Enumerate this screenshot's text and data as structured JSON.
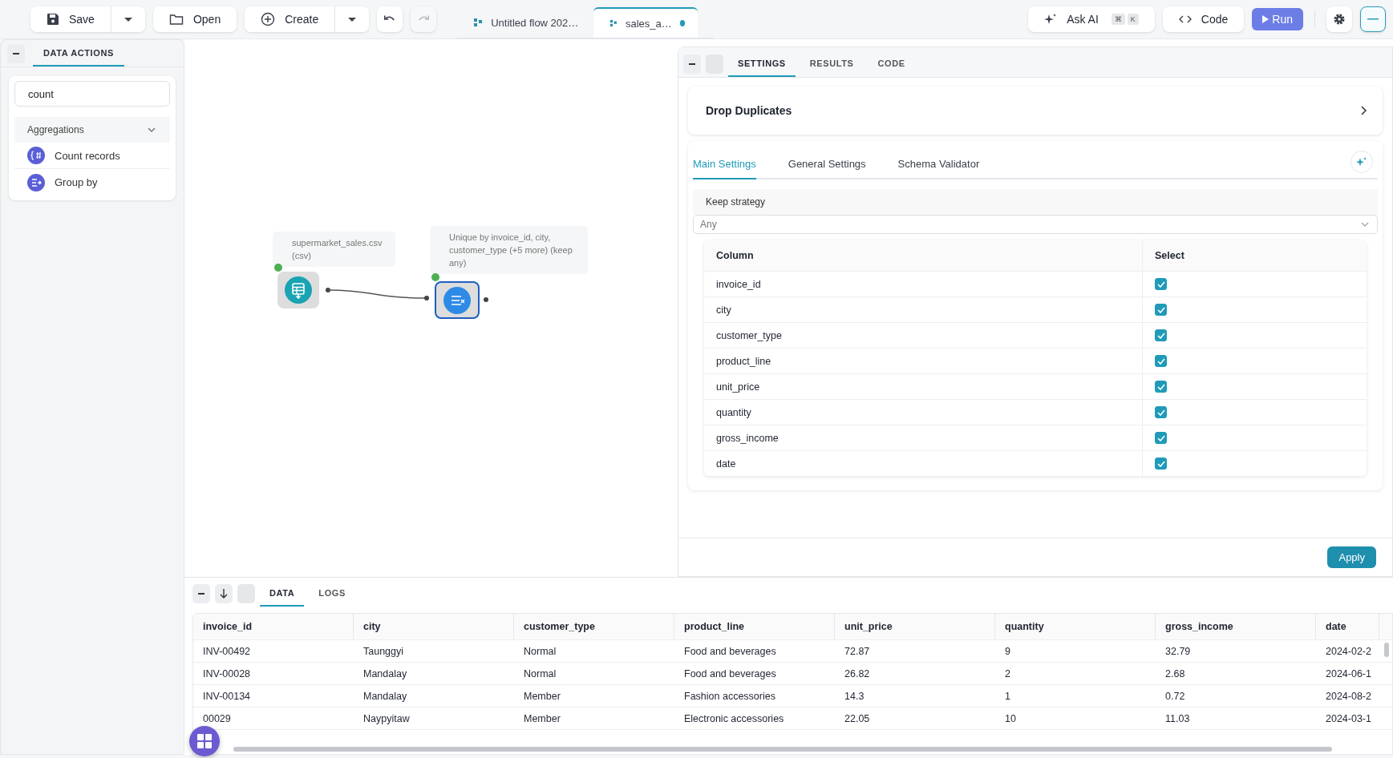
{
  "toolbar": {
    "save": {
      "label": "Save"
    },
    "open": {
      "label": "Open"
    },
    "create": {
      "label": "Create"
    },
    "undo": {
      "disabled": false
    },
    "redo": {
      "disabled": true
    }
  },
  "file_tabs": [
    {
      "label": "Untitled flow 202…",
      "selected": false,
      "unsaved": false
    },
    {
      "label": "sales_a…",
      "selected": true,
      "unsaved": true
    }
  ],
  "ask_ai": {
    "label": "Ask AI",
    "keys": [
      "⌘",
      "K"
    ]
  },
  "code_button": {
    "label": "Code"
  },
  "run_button": {
    "label": "Run"
  },
  "left_panel": {
    "tab": "DATA ACTIONS",
    "search": {
      "value": "count"
    },
    "groups": [
      {
        "label": "Aggregations",
        "expanded": true,
        "items": [
          {
            "label": "Count records",
            "kind": "count"
          },
          {
            "label": "Group by",
            "kind": "group"
          }
        ]
      }
    ]
  },
  "canvas": {
    "nodes": [
      {
        "kind": "csv",
        "label": "supermarket_sales.csv (csv)",
        "selected": false
      },
      {
        "kind": "drop",
        "label": "Unique by invoice_id, city, customer_type (+5 more) (keep any)",
        "selected": true
      }
    ]
  },
  "settings_panel": {
    "tabs": [
      {
        "label": "SETTINGS",
        "selected": true
      },
      {
        "label": "RESULTS",
        "selected": false
      },
      {
        "label": "CODE",
        "selected": false
      }
    ],
    "title": "Drop Duplicates",
    "subtabs": [
      {
        "label": "Main Settings",
        "selected": true
      },
      {
        "label": "General Settings",
        "selected": false
      },
      {
        "label": "Schema Validator",
        "selected": false
      }
    ],
    "keep_strategy": {
      "label": "Keep strategy",
      "value": "Any"
    },
    "columns_table": {
      "columns": [
        "Column",
        "Select"
      ],
      "rows": [
        {
          "name": "invoice_id",
          "checked": true
        },
        {
          "name": "city",
          "checked": true
        },
        {
          "name": "customer_type",
          "checked": true
        },
        {
          "name": "product_line",
          "checked": true
        },
        {
          "name": "unit_price",
          "checked": true
        },
        {
          "name": "quantity",
          "checked": true
        },
        {
          "name": "gross_income",
          "checked": true
        },
        {
          "name": "date",
          "checked": true
        }
      ]
    },
    "apply": {
      "label": "Apply"
    }
  },
  "data_panel": {
    "tabs": [
      {
        "label": "DATA",
        "selected": true
      },
      {
        "label": "LOGS",
        "selected": false
      }
    ],
    "table": {
      "columns": [
        "invoice_id",
        "city",
        "customer_type",
        "product_line",
        "unit_price",
        "quantity",
        "gross_income",
        "date"
      ],
      "rows": [
        [
          "INV-00492",
          "Taunggyi",
          "Normal",
          "Food and beverages",
          "72.87",
          "9",
          "32.79",
          "2024-02-2"
        ],
        [
          "INV-00028",
          "Mandalay",
          "Normal",
          "Food and beverages",
          "26.82",
          "2",
          "2.68",
          "2024-06-1"
        ],
        [
          "INV-00134",
          "Mandalay",
          "Member",
          "Fashion accessories",
          "14.3",
          "1",
          "0.72",
          "2024-08-2"
        ],
        [
          "00029",
          "Naypyitaw",
          "Member",
          "Electronic accessories",
          "22.05",
          "10",
          "11.03",
          "2024-03-1"
        ]
      ]
    }
  }
}
